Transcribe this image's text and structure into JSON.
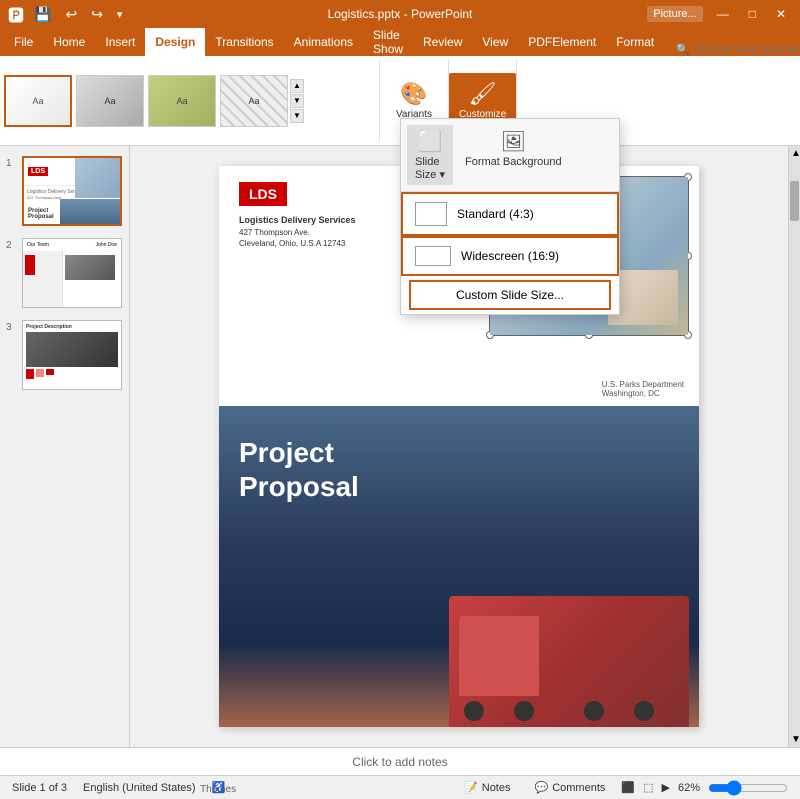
{
  "titlebar": {
    "filename": "Logistics.pptx - PowerPoint",
    "context_tab": "Picture...",
    "minimize": "—",
    "maximize": "□",
    "close": "✕"
  },
  "quickaccess": {
    "save": "💾",
    "undo": "↩",
    "redo": "↪",
    "customize": "⚙"
  },
  "tabs": [
    {
      "label": "File",
      "active": false
    },
    {
      "label": "Home",
      "active": false
    },
    {
      "label": "Insert",
      "active": false
    },
    {
      "label": "Design",
      "active": true
    },
    {
      "label": "Transitions",
      "active": false
    },
    {
      "label": "Animations",
      "active": false
    },
    {
      "label": "Slide Show",
      "active": false
    },
    {
      "label": "Review",
      "active": false
    },
    {
      "label": "View",
      "active": false
    },
    {
      "label": "PDFElement",
      "active": false
    },
    {
      "label": "Format",
      "active": false
    }
  ],
  "ribbon": {
    "themes_label": "Themes",
    "variants_label": "Variants",
    "customize_label": "Customize",
    "slide_size_label": "Slide\nSize",
    "format_bg_label": "Format\nBackground"
  },
  "dropdown": {
    "slide_size_label": "Slide\nSize ▾",
    "format_bg_label": "Format\nBackground",
    "standard_label": "Standard (4:3)",
    "widescreen_label": "Widescreen (16:9)",
    "custom_label": "Custom Slide Size..."
  },
  "slides": [
    {
      "num": "1"
    },
    {
      "num": "2"
    },
    {
      "num": "3"
    }
  ],
  "slide1": {
    "logo": "LDS",
    "company": "Logistics Delivery Services",
    "address1": "427 Thompson Ave.",
    "address2": "Cleveland, Ohio, U.S.A 12743",
    "dept1": "U.S. Parks Department",
    "dept2": "Washington, DC",
    "title1": "Project",
    "title2": "Proposal"
  },
  "statusbar": {
    "slide_info": "Slide 1 of 3",
    "language": "English (United States)",
    "notes": "Notes",
    "comments": "Comments",
    "zoom": "62%"
  },
  "notes_bar": {
    "label": "Click to add notes"
  },
  "tell_me": {
    "placeholder": "Tell me what you want to do..."
  }
}
